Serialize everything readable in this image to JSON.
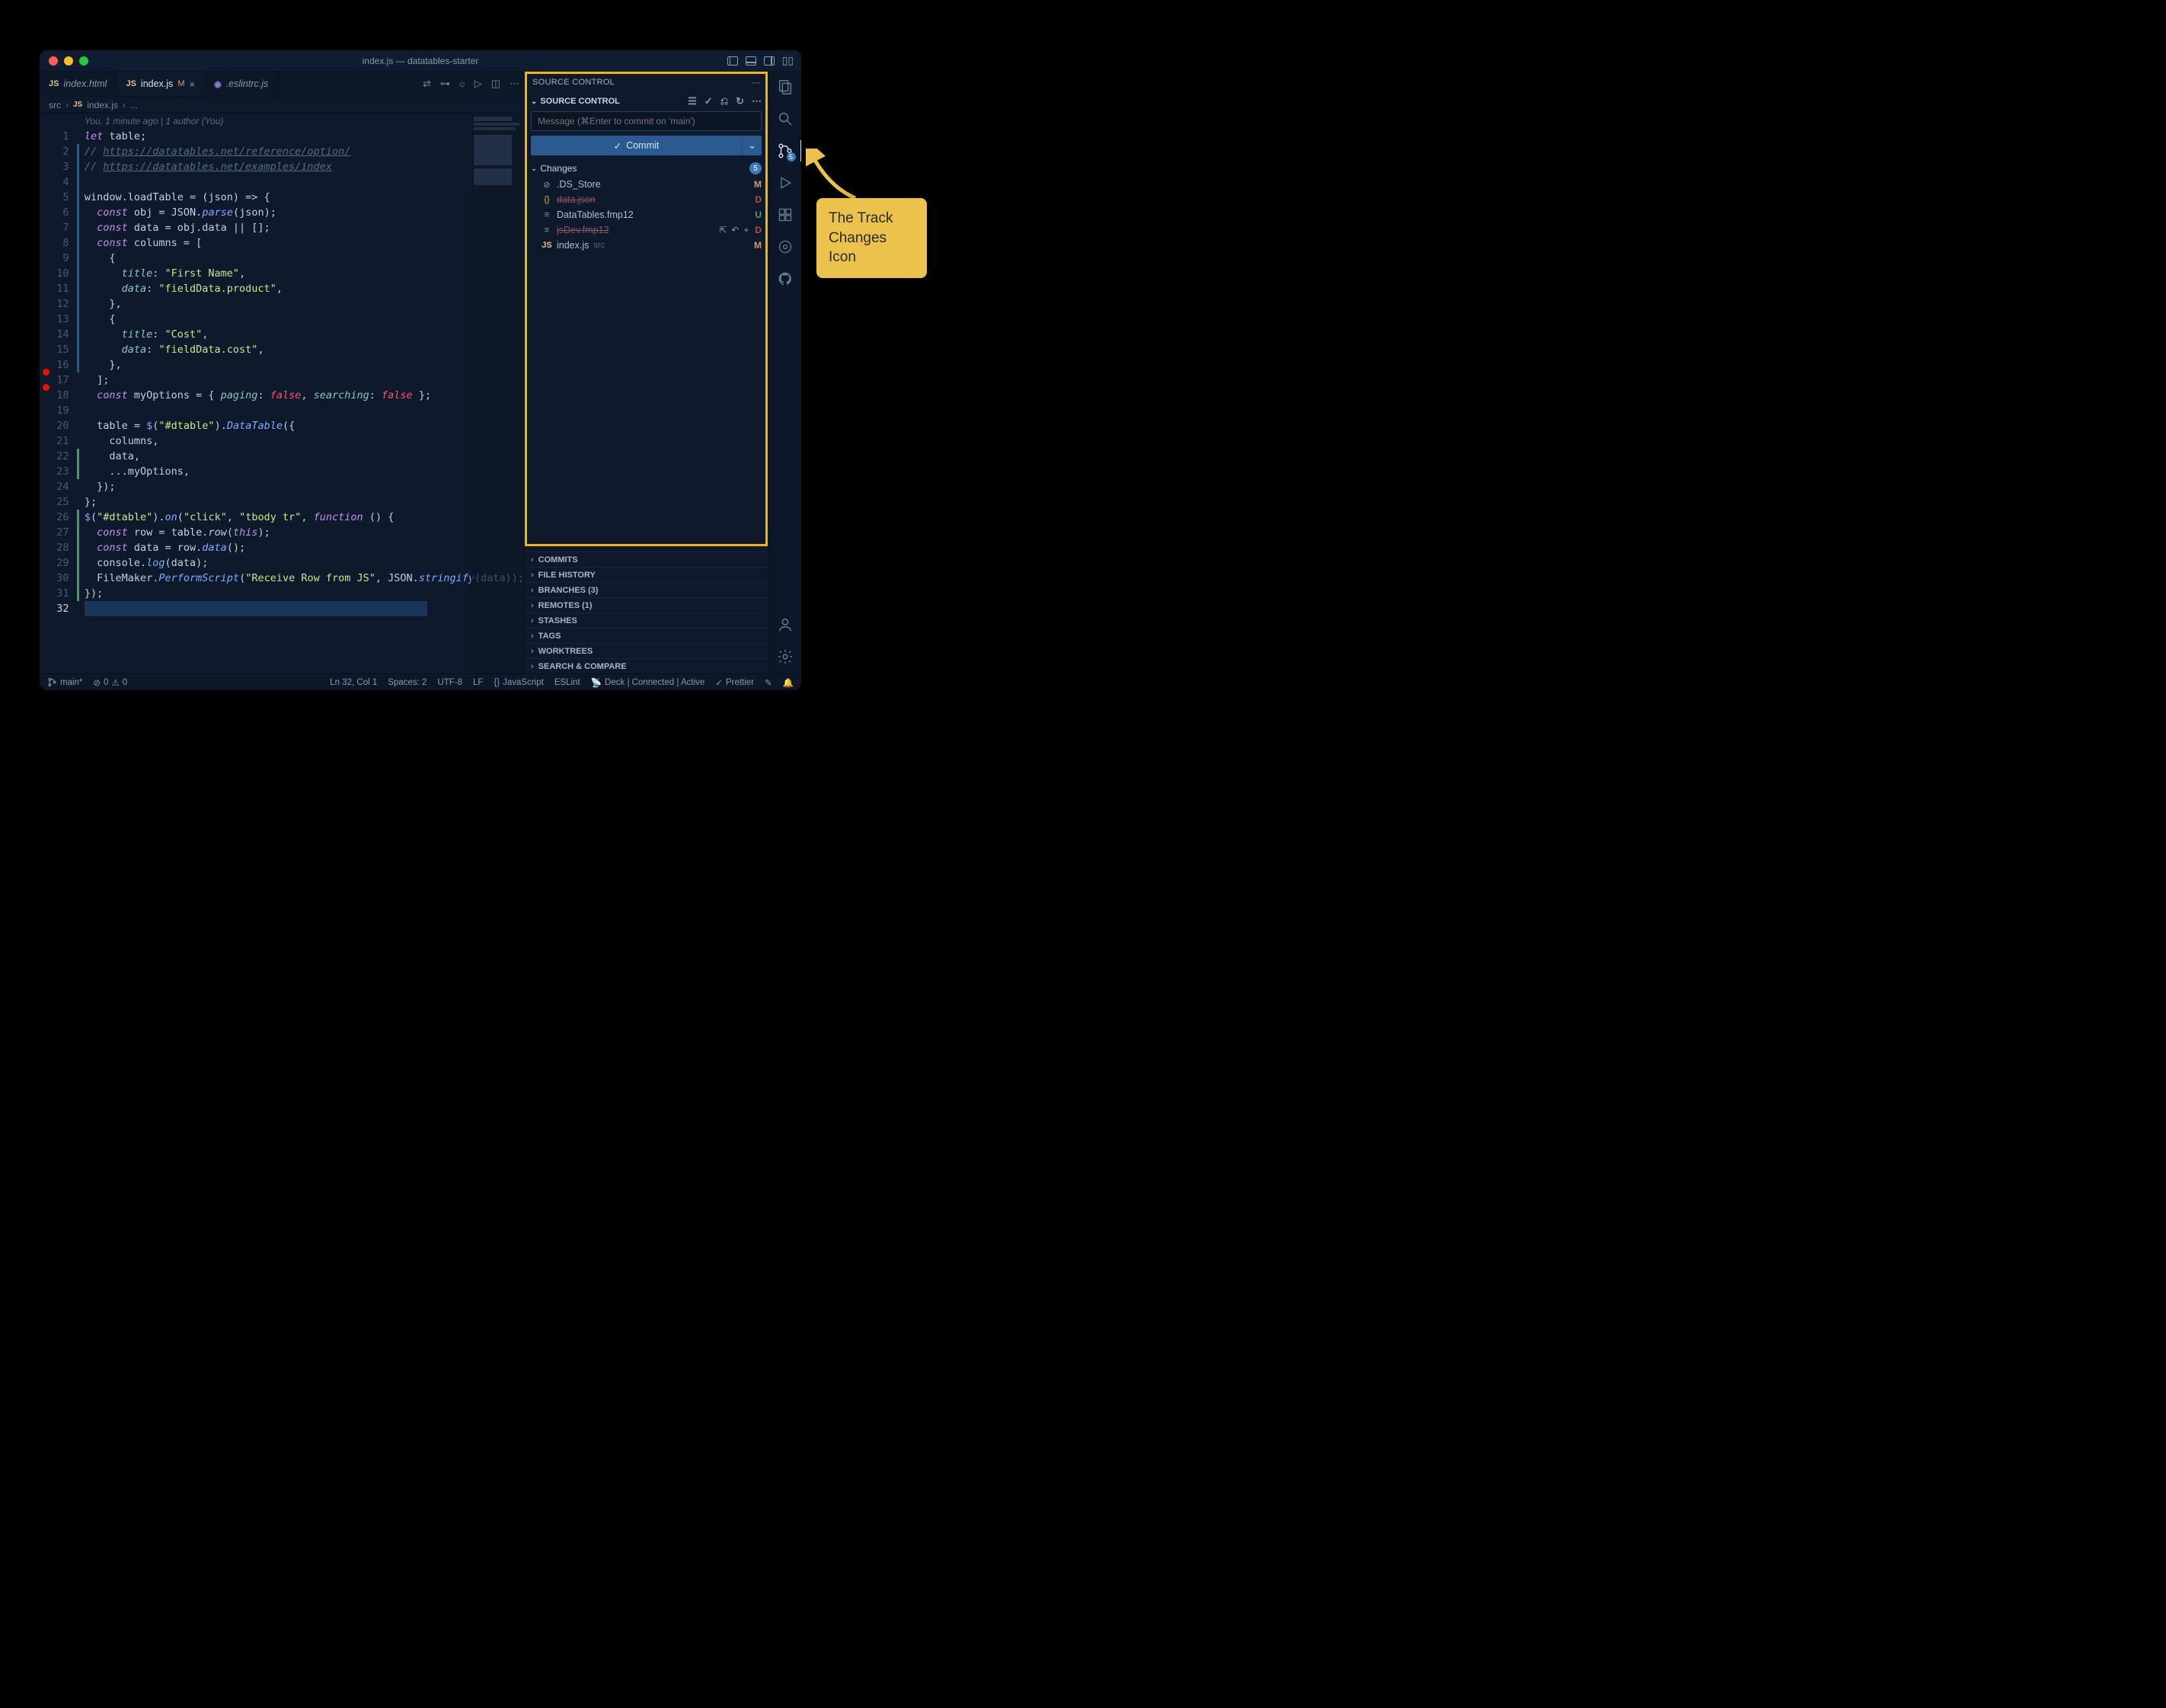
{
  "window": {
    "title": "index.js — datatables-starter"
  },
  "tabs": [
    {
      "icon": "JS",
      "iconClass": "html",
      "label": "index.html",
      "active": false,
      "modified": false
    },
    {
      "icon": "JS",
      "iconClass": "js",
      "label": "index.js",
      "active": true,
      "modified": true,
      "suffix": "M"
    },
    {
      "icon": "◉",
      "iconClass": "eslint",
      "label": ".eslintrc.js",
      "active": false,
      "modified": false
    }
  ],
  "breadcrumbs": {
    "parts": [
      "src",
      "index.js"
    ],
    "icon": "JS",
    "trailing": "..."
  },
  "editor": {
    "blame": "You, 1 minute ago | 1 author (You)",
    "breakpoint_lines": [
      17,
      18
    ],
    "cursor_line": 32,
    "change_segments": [
      {
        "from": 2,
        "to": 16,
        "kind": "mod"
      },
      {
        "from": 22,
        "to": 23,
        "kind": "add"
      },
      {
        "from": 26,
        "to": 31,
        "kind": "add"
      }
    ],
    "lines": [
      "let table;",
      "// https://datatables.net/reference/option/",
      "// https://datatables.net/examples/index",
      "",
      "window.loadTable = (json) => {",
      "  const obj = JSON.parse(json);",
      "  const data = obj.data || [];",
      "  const columns = [",
      "    {",
      "      title: \"First Name\",",
      "      data: \"fieldData.product\",",
      "    },",
      "    {",
      "      title: \"Cost\",",
      "      data: \"fieldData.cost\",",
      "    },",
      "  ];",
      "  const myOptions = { paging: false, searching: false };",
      "",
      "  table = $(\"#dtable\").DataTable({",
      "    columns,",
      "    data,",
      "    ...myOptions,",
      "  });",
      "};",
      "$(\"#dtable\").on(\"click\", \"tbody tr\", function () {",
      "  const row = table.row(this);",
      "  const data = row.data();",
      "  console.log(data);",
      "  FileMaker.PerformScript(\"Receive Row from JS\", JSON.stringify(data));",
      "});",
      ""
    ]
  },
  "scm": {
    "title": "SOURCE CONTROL",
    "header": "SOURCE CONTROL",
    "msg_placeholder": "Message (⌘Enter to commit on 'main')",
    "commit_label": "Commit",
    "changes_label": "Changes",
    "changes_count": "5",
    "files": [
      {
        "icon": "⊘",
        "iconClass": "db",
        "name": ".DS_Store",
        "path": "",
        "status": "M",
        "deleted": false
      },
      {
        "icon": "{}",
        "iconClass": "json",
        "name": "data.json",
        "path": "",
        "status": "D",
        "deleted": true
      },
      {
        "icon": "≡",
        "iconClass": "db",
        "name": "DataTables.fmp12",
        "path": "",
        "status": "U",
        "deleted": false
      },
      {
        "icon": "≡",
        "iconClass": "db",
        "name": "jsDev.fmp12",
        "path": "",
        "status": "D",
        "deleted": true,
        "hover": true
      },
      {
        "icon": "JS",
        "iconClass": "js2",
        "name": "index.js",
        "path": "src",
        "status": "M",
        "deleted": false
      }
    ],
    "sections": [
      "COMMITS",
      "FILE HISTORY",
      "BRANCHES (3)",
      "REMOTES (1)",
      "STASHES",
      "TAGS",
      "WORKTREES",
      "SEARCH & COMPARE"
    ]
  },
  "activitybar": {
    "top": [
      {
        "name": "explorer-icon",
        "glyph": "files",
        "active": false
      },
      {
        "name": "search-icon",
        "glyph": "search",
        "active": false
      },
      {
        "name": "scm-icon",
        "glyph": "branch",
        "active": true,
        "badge": "5"
      },
      {
        "name": "run-icon",
        "glyph": "play",
        "active": false
      },
      {
        "name": "extensions-icon",
        "glyph": "ext",
        "active": false
      },
      {
        "name": "gitlens-icon",
        "glyph": "gitlens",
        "active": false
      },
      {
        "name": "github-icon",
        "glyph": "github",
        "active": false
      }
    ],
    "bottom": [
      {
        "name": "account-icon",
        "glyph": "account"
      },
      {
        "name": "settings-icon",
        "glyph": "gear"
      }
    ]
  },
  "statusbar": {
    "branch": "main*",
    "errors": "0",
    "warnings": "0",
    "position": "Ln 32, Col 1",
    "spaces": "Spaces: 2",
    "encoding": "UTF-8",
    "eol": "LF",
    "language_icon": "{}",
    "language": "JavaScript",
    "eslint": "ESLint",
    "deck": "Deck | Connected | Active",
    "prettier": "Prettier"
  },
  "callout": {
    "text": "The Track Changes Icon"
  }
}
